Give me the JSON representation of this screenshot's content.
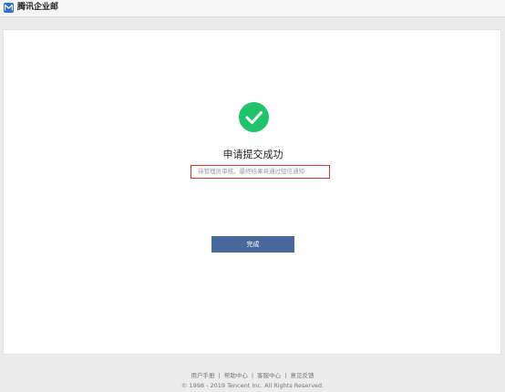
{
  "header": {
    "brand": "腾讯企业邮",
    "logo_color": "#2f6fd4"
  },
  "main": {
    "status_icon": "check-circle-icon",
    "status_color": "#20c26b",
    "title": "申请提交成功",
    "subtitle": "待管理员审核，最终结果将通过短信通知",
    "done_label": "完成",
    "button_color": "#49699c"
  },
  "footer": {
    "links": [
      "用户手册",
      "帮助中心",
      "客服中心",
      "意见反馈"
    ],
    "copyright": "© 1998 - 2019 Tencent Inc. All Rights Reserved."
  }
}
